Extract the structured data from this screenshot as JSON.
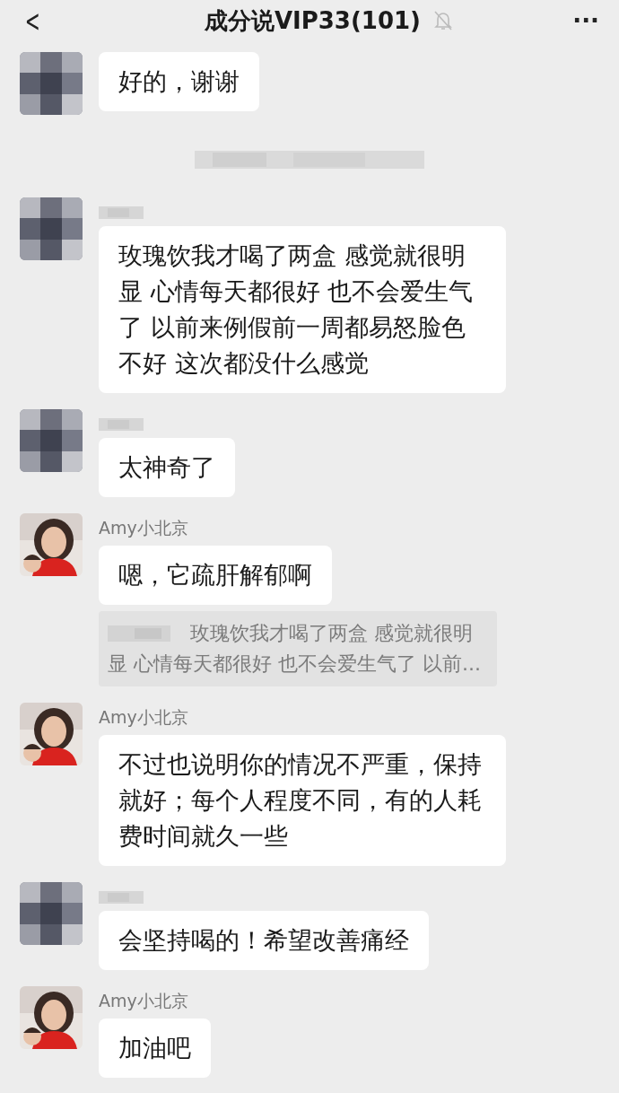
{
  "header": {
    "back": "<",
    "title": "成分说VIP33(101)",
    "muted": true,
    "more": "···"
  },
  "items": [
    {
      "kind": "message",
      "name_blurred": false,
      "text": "好的，谢谢"
    },
    {
      "kind": "blurred_notice"
    },
    {
      "kind": "message",
      "name_blurred": true,
      "text": "玫瑰饮我才喝了两盒 感觉就很明显 心情每天都很好 也不会爱生气了 以前来例假前一周都易怒脸色不好 这次都没什么感觉"
    },
    {
      "kind": "message",
      "name_blurred": true,
      "text": "太神奇了"
    },
    {
      "kind": "message",
      "sender_name": "Amy小北京",
      "text": "嗯，它疏肝解郁啊",
      "quote_lines": [
        "玫瑰饮我才喝了两盒 感觉就很明",
        "显 心情每天都很好 也不会爱生气了 以前..."
      ]
    },
    {
      "kind": "message",
      "sender_name": "Amy小北京",
      "text": "不过也说明你的情况不严重，保持就好；每个人程度不同，有的人耗费时间就久一些"
    },
    {
      "kind": "message",
      "name_blurred": true,
      "text": "会坚持喝的！希望改善痛经"
    },
    {
      "kind": "message",
      "sender_name": "Amy小北京",
      "text": "加油吧"
    }
  ]
}
